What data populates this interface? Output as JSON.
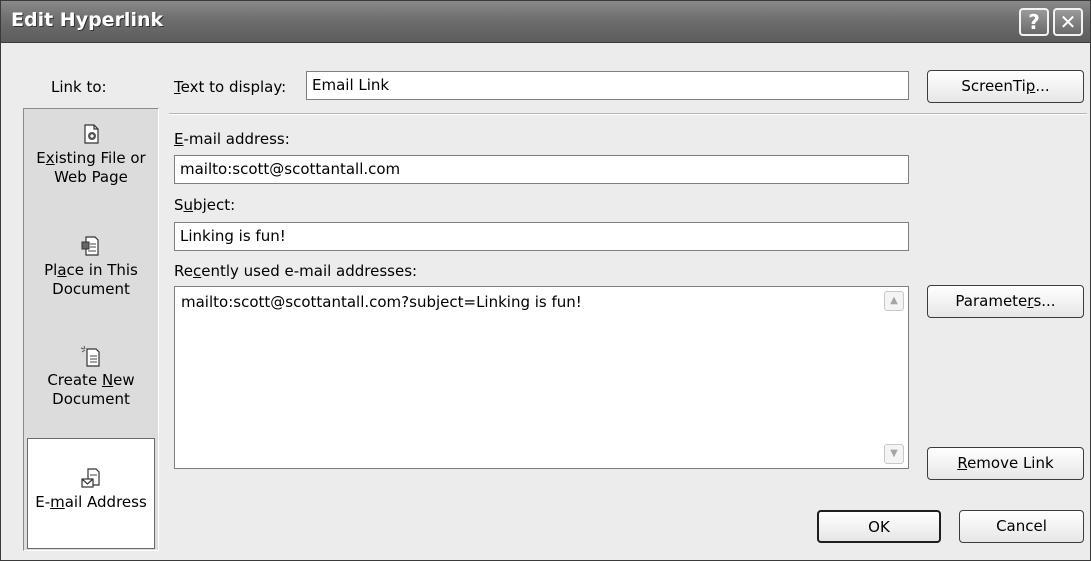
{
  "window": {
    "title": "Edit Hyperlink",
    "help_glyph": "?",
    "close_glyph": "✕"
  },
  "link_to": {
    "label": "Link to:",
    "items": [
      {
        "pre": "E",
        "mn": "x",
        "post": "isting File or",
        "line2": "Web Page",
        "icon": "file-icon"
      },
      {
        "pre": "Pl",
        "mn": "a",
        "post": "ce in This",
        "line2": "Document",
        "icon": "document-place-icon"
      },
      {
        "pre": "Create ",
        "mn": "N",
        "post": "ew",
        "line2": "Document",
        "icon": "new-document-icon"
      },
      {
        "pre": "E-",
        "mn": "m",
        "post": "ail Address",
        "line2": "",
        "icon": "email-icon",
        "active": true
      }
    ]
  },
  "text_to_display": {
    "pre": "",
    "mn": "T",
    "post": "ext to display:",
    "value": "Email Link"
  },
  "email": {
    "pre": "",
    "mn": "E",
    "post": "-mail address:",
    "value": "mailto:scott@scottantall.com"
  },
  "subject": {
    "pre": "S",
    "mn": "u",
    "post": "bject:",
    "value": "Linking is fun!"
  },
  "recent": {
    "pre": "Re",
    "mn": "c",
    "post": "ently used e-mail addresses:",
    "items": [
      "mailto:scott@scottantall.com?subject=Linking is fun!"
    ]
  },
  "buttons": {
    "screentip": {
      "pre": "ScreenTi",
      "mn": "p",
      "post": "..."
    },
    "parameters": {
      "pre": "Paramete",
      "mn": "r",
      "post": "s..."
    },
    "remove_link": {
      "pre": "",
      "mn": "R",
      "post": "emove Link"
    },
    "ok": "OK",
    "cancel": "Cancel"
  }
}
